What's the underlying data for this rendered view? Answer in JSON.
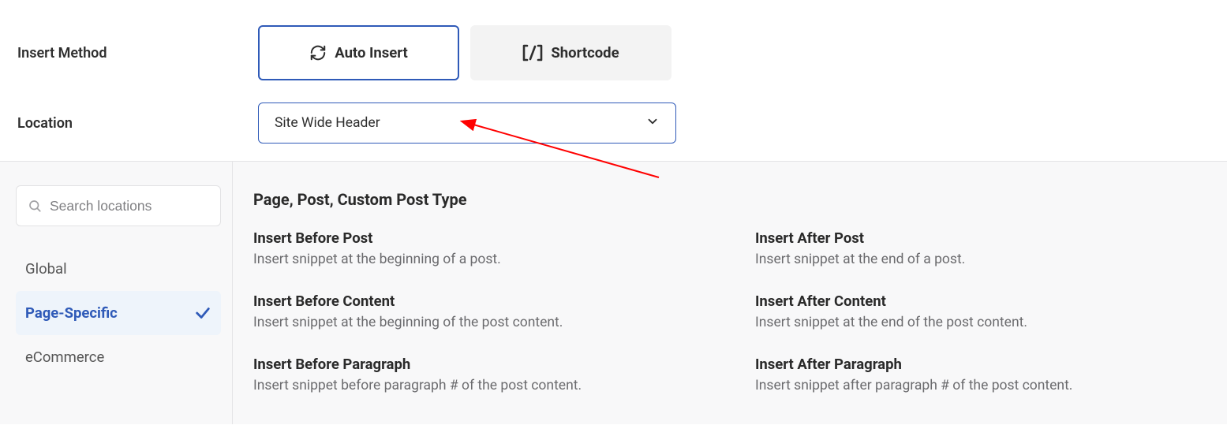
{
  "form": {
    "insert_method_label": "Insert Method",
    "location_label": "Location"
  },
  "methods": {
    "auto_insert": "Auto Insert",
    "shortcode": "Shortcode"
  },
  "location": {
    "selected": "Site Wide Header"
  },
  "search": {
    "placeholder": "Search locations"
  },
  "sidebar": {
    "global": "Global",
    "page_specific": "Page-Specific",
    "ecommerce": "eCommerce"
  },
  "panel": {
    "group_title": "Page, Post, Custom Post Type",
    "options": [
      {
        "title": "Insert Before Post",
        "desc": "Insert snippet at the beginning of a post."
      },
      {
        "title": "Insert After Post",
        "desc": "Insert snippet at the end of a post."
      },
      {
        "title": "Insert Before Content",
        "desc": "Insert snippet at the beginning of the post content."
      },
      {
        "title": "Insert After Content",
        "desc": "Insert snippet at the end of the post content."
      },
      {
        "title": "Insert Before Paragraph",
        "desc": "Insert snippet before paragraph # of the post content."
      },
      {
        "title": "Insert After Paragraph",
        "desc": "Insert snippet after paragraph # of the post content."
      }
    ]
  }
}
